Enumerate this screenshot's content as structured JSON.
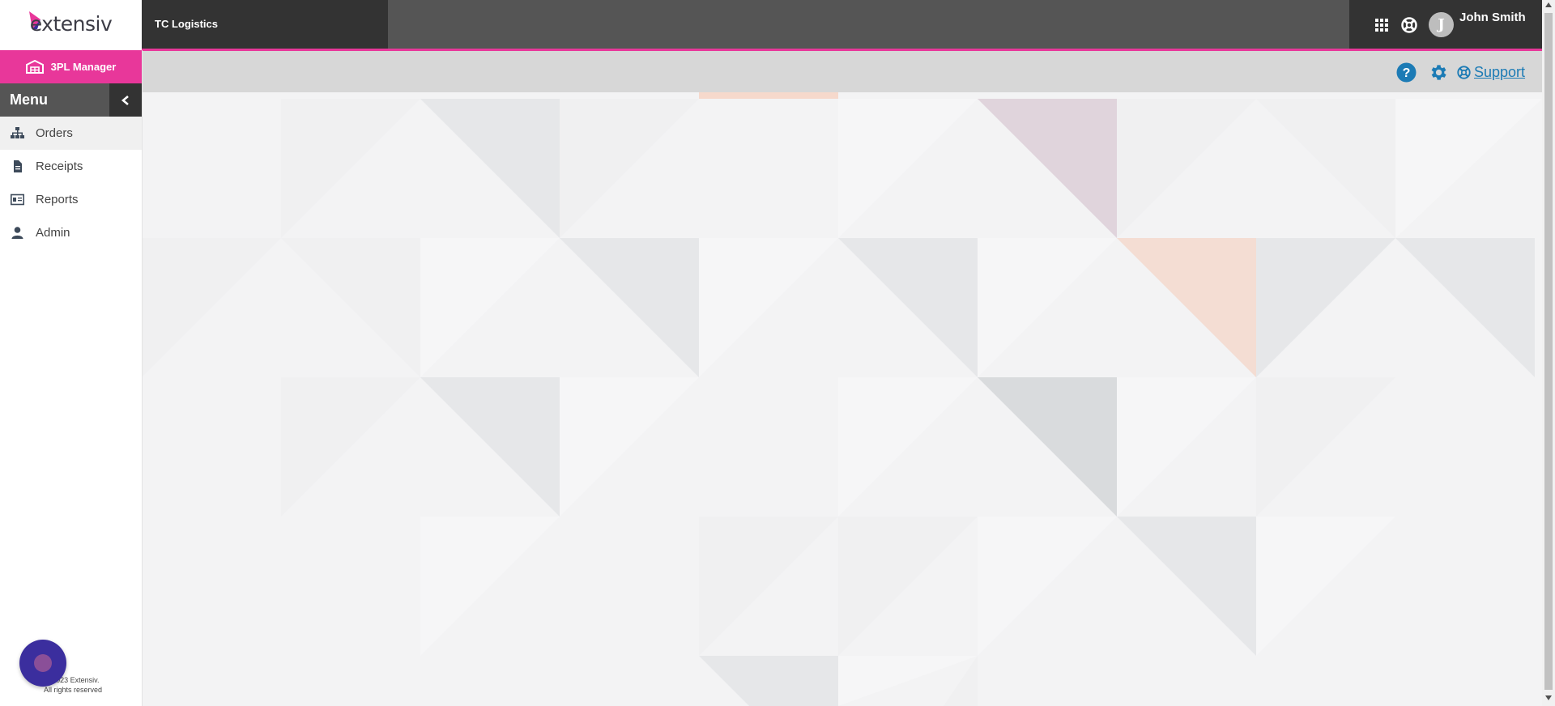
{
  "brand": {
    "logo_text": "extensiv"
  },
  "header": {
    "company_name": "TC Logistics",
    "user_initial": "J",
    "user_name": "John Smith",
    "icons": [
      "apps-grid-icon",
      "lifebuoy-icon",
      "avatar"
    ]
  },
  "subbar": {
    "icons": [
      "help-icon",
      "gear-icon",
      "lifebuoy-icon"
    ],
    "support_label": "Support"
  },
  "sidebar": {
    "product_label": "3PL Manager",
    "menu_title": "Menu",
    "items": [
      {
        "label": "Orders",
        "icon": "sitemap-icon",
        "active": true
      },
      {
        "label": "Receipts",
        "icon": "file-icon",
        "active": false
      },
      {
        "label": "Reports",
        "icon": "id-card-icon",
        "active": false
      },
      {
        "label": "Admin",
        "icon": "user-icon",
        "active": false
      }
    ],
    "copyright_line1": "©2023 Extensiv.",
    "copyright_line2": "All rights reserved"
  },
  "colors": {
    "accent_pink": "#e8379a",
    "header_dark": "#333333",
    "header_mid": "#555555",
    "link_blue": "#1c7bb5",
    "chat_bubble": "#3b2e9e"
  }
}
